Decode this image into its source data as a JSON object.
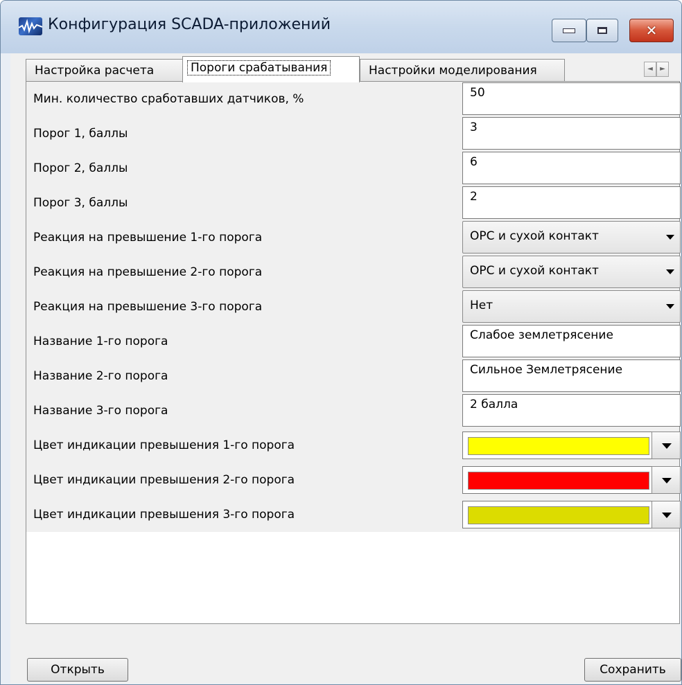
{
  "window": {
    "title": "Конфигурация SCADA-приложений"
  },
  "tabs": [
    {
      "label": "Настройка расчета",
      "active": false
    },
    {
      "label": "Пороги срабатывания",
      "active": true
    },
    {
      "label": "Настройки моделирования",
      "active": false
    }
  ],
  "tab_scroll": {
    "left": "◄",
    "right": "►"
  },
  "rows": [
    {
      "label": "Мин. количество сработавших датчиков, %",
      "value": "50"
    },
    {
      "label": "Порог 1, баллы",
      "value": "3"
    },
    {
      "label": "Порог 2, баллы",
      "value": "6"
    },
    {
      "label": "Порог 3, баллы",
      "value": "2"
    },
    {
      "label": "Реакция на превышение 1-го порога",
      "value": "OPC и сухой контакт"
    },
    {
      "label": "Реакция на превышение 2-го порога",
      "value": "OPC и сухой контакт"
    },
    {
      "label": "Реакция на превышение 3-го порога",
      "value": "Нет"
    },
    {
      "label": "Название 1-го порога",
      "value": "Слабое землетрясение"
    },
    {
      "label": "Название 2-го порога",
      "value": "Сильное Землетрясение"
    },
    {
      "label": "Название 3-го порога",
      "value": "2 балла"
    },
    {
      "label": "Цвет индикации превышения 1-го порога",
      "color": "#ffff00"
    },
    {
      "label": "Цвет индикации превышения 2-го порога",
      "color": "#ff0000"
    },
    {
      "label": "Цвет индикации превышения 3-го порога",
      "color": "#dcdc00"
    }
  ],
  "buttons": {
    "open": "Открыть",
    "save": "Сохранить"
  },
  "icons": {
    "app": "app-icon",
    "minimize": "minimize-icon",
    "maximize": "maximize-icon",
    "close": "close-icon",
    "dropdown": "chevron-down-icon"
  }
}
